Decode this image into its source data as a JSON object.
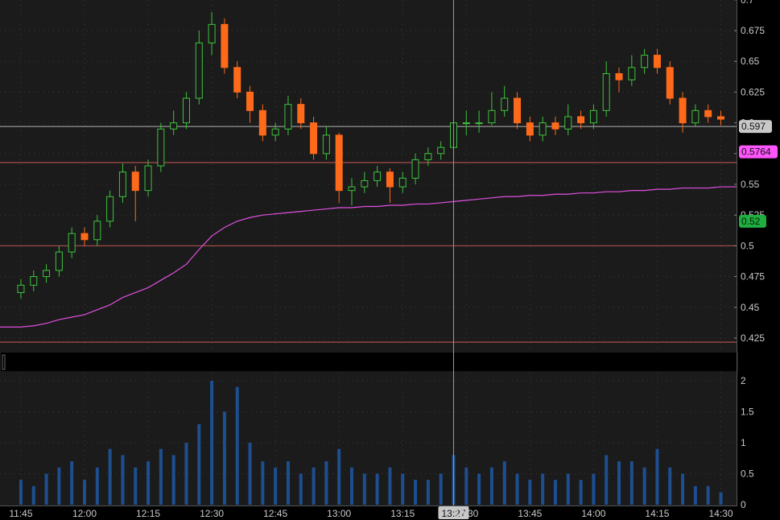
{
  "chart_data": {
    "type": "candlestick",
    "title": "",
    "interval_minutes": 3,
    "start_time": "11:45",
    "price_axis": {
      "ylim": [
        0.415,
        0.7
      ],
      "ticks": [
        "0.425",
        "0.45",
        "0.475",
        "0.5",
        "0.525",
        "0.55",
        "0.575",
        "0.6",
        "0.625",
        "0.65",
        "0.675",
        "0.7"
      ]
    },
    "volume_axis": {
      "ylim": [
        0,
        2.1
      ],
      "ticks": [
        "0",
        "0.5",
        "1",
        "1.5",
        "2"
      ]
    },
    "time_ticks": [
      "11:45",
      "12:00",
      "12:15",
      "12:30",
      "12:45",
      "13:00",
      "13:15",
      "13:30",
      "13:45",
      "14:00",
      "14:15",
      "14:30"
    ],
    "candles": [
      [
        0.462,
        0.473,
        0.457,
        0.468
      ],
      [
        0.468,
        0.48,
        0.463,
        0.475
      ],
      [
        0.475,
        0.485,
        0.47,
        0.48
      ],
      [
        0.48,
        0.5,
        0.475,
        0.495
      ],
      [
        0.495,
        0.515,
        0.49,
        0.51
      ],
      [
        0.51,
        0.515,
        0.5,
        0.505
      ],
      [
        0.505,
        0.525,
        0.5,
        0.52
      ],
      [
        0.52,
        0.545,
        0.515,
        0.54
      ],
      [
        0.54,
        0.567,
        0.535,
        0.56
      ],
      [
        0.56,
        0.565,
        0.52,
        0.545
      ],
      [
        0.545,
        0.57,
        0.54,
        0.565
      ],
      [
        0.565,
        0.6,
        0.56,
        0.595
      ],
      [
        0.595,
        0.61,
        0.59,
        0.6
      ],
      [
        0.6,
        0.625,
        0.595,
        0.62
      ],
      [
        0.62,
        0.675,
        0.615,
        0.665
      ],
      [
        0.665,
        0.69,
        0.655,
        0.68
      ],
      [
        0.68,
        0.685,
        0.64,
        0.645
      ],
      [
        0.645,
        0.65,
        0.62,
        0.625
      ],
      [
        0.625,
        0.63,
        0.6,
        0.61
      ],
      [
        0.61,
        0.615,
        0.585,
        0.59
      ],
      [
        0.59,
        0.6,
        0.585,
        0.595
      ],
      [
        0.595,
        0.622,
        0.59,
        0.615
      ],
      [
        0.615,
        0.62,
        0.595,
        0.6
      ],
      [
        0.6,
        0.605,
        0.57,
        0.575
      ],
      [
        0.575,
        0.597,
        0.57,
        0.59
      ],
      [
        0.59,
        0.592,
        0.535,
        0.545
      ],
      [
        0.545,
        0.555,
        0.533,
        0.548
      ],
      [
        0.548,
        0.56,
        0.543,
        0.553
      ],
      [
        0.553,
        0.565,
        0.548,
        0.56
      ],
      [
        0.56,
        0.563,
        0.535,
        0.548
      ],
      [
        0.548,
        0.56,
        0.543,
        0.555
      ],
      [
        0.555,
        0.575,
        0.55,
        0.57
      ],
      [
        0.57,
        0.58,
        0.565,
        0.575
      ],
      [
        0.575,
        0.585,
        0.57,
        0.58
      ],
      [
        0.58,
        0.622,
        0.575,
        0.6
      ],
      [
        0.6,
        0.61,
        0.59,
        0.6
      ],
      [
        0.6,
        0.61,
        0.592,
        0.6
      ],
      [
        0.6,
        0.625,
        0.598,
        0.61
      ],
      [
        0.61,
        0.63,
        0.605,
        0.62
      ],
      [
        0.62,
        0.625,
        0.595,
        0.6
      ],
      [
        0.6,
        0.605,
        0.585,
        0.59
      ],
      [
        0.59,
        0.605,
        0.585,
        0.6
      ],
      [
        0.6,
        0.605,
        0.59,
        0.595
      ],
      [
        0.595,
        0.615,
        0.59,
        0.605
      ],
      [
        0.605,
        0.61,
        0.595,
        0.6
      ],
      [
        0.6,
        0.615,
        0.595,
        0.61
      ],
      [
        0.61,
        0.65,
        0.605,
        0.64
      ],
      [
        0.64,
        0.645,
        0.625,
        0.635
      ],
      [
        0.635,
        0.655,
        0.63,
        0.645
      ],
      [
        0.645,
        0.66,
        0.64,
        0.655
      ],
      [
        0.655,
        0.66,
        0.64,
        0.645
      ],
      [
        0.645,
        0.65,
        0.615,
        0.62
      ],
      [
        0.62,
        0.625,
        0.592,
        0.6
      ],
      [
        0.6,
        0.615,
        0.597,
        0.61
      ],
      [
        0.61,
        0.615,
        0.6,
        0.605
      ],
      [
        0.605,
        0.61,
        0.598,
        0.603
      ]
    ],
    "volume": [
      0.4,
      0.3,
      0.5,
      0.6,
      0.7,
      0.4,
      0.6,
      0.9,
      0.8,
      0.6,
      0.7,
      0.9,
      0.8,
      1.0,
      1.3,
      2.0,
      1.5,
      1.9,
      1.0,
      0.7,
      0.6,
      0.7,
      0.5,
      0.6,
      0.7,
      0.9,
      0.6,
      0.5,
      0.5,
      0.6,
      0.5,
      0.4,
      0.4,
      0.5,
      0.8,
      0.6,
      0.5,
      0.6,
      0.7,
      0.5,
      0.4,
      0.5,
      0.4,
      0.5,
      0.4,
      0.5,
      0.8,
      0.7,
      0.7,
      0.6,
      0.9,
      0.6,
      0.5,
      0.3,
      0.3,
      0.2
    ],
    "vwap": [
      0.434,
      0.435,
      0.437,
      0.44,
      0.442,
      0.444,
      0.448,
      0.452,
      0.458,
      0.462,
      0.466,
      0.472,
      0.478,
      0.485,
      0.497,
      0.508,
      0.515,
      0.52,
      0.523,
      0.525,
      0.526,
      0.527,
      0.528,
      0.529,
      0.53,
      0.531,
      0.531,
      0.532,
      0.532,
      0.533,
      0.533,
      0.534,
      0.534,
      0.535,
      0.536,
      0.537,
      0.538,
      0.539,
      0.54,
      0.54,
      0.541,
      0.541,
      0.542,
      0.542,
      0.543,
      0.543,
      0.544,
      0.544,
      0.545,
      0.545,
      0.546,
      0.546,
      0.547,
      0.547,
      0.547,
      0.548
    ],
    "horizontal_lines": [
      {
        "name": "last-price-line",
        "value": 0.597,
        "color": "#8a8a8a"
      },
      {
        "name": "level-line",
        "value": 0.5677,
        "color": "#a04848"
      },
      {
        "name": "level-line",
        "value": 0.5,
        "color": "#a04848"
      },
      {
        "name": "level-line",
        "value": 0.4217,
        "color": "#a04848"
      }
    ],
    "price_tags": [
      {
        "name": "last-price-tag",
        "label": "0.597",
        "value": 0.597,
        "bg": "#c8c8c8",
        "fg": "#111111"
      },
      {
        "name": "vwap-tag",
        "label": "0.5764",
        "value": 0.5764,
        "bg": "#ff55ff",
        "fg": "#111111"
      },
      {
        "name": "bid-tag",
        "label": "0.52",
        "value": 0.52,
        "bg": "#1fae3f",
        "fg": "#0a1a0a"
      }
    ],
    "crosshair": {
      "time": "13:27",
      "minute_of_day": 807
    },
    "colors": {
      "up": "#3ec33e",
      "down": "#ff6a1a",
      "vwap": "#e050e0",
      "volume": "#1d4f90",
      "grid": "#3a3a3a",
      "bg": "#1b1b1b"
    }
  }
}
